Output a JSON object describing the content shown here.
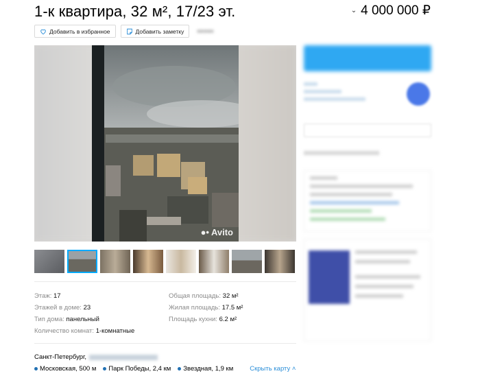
{
  "listing": {
    "title": "1-к квартира, 32 м², 17/23 эт.",
    "price": "4 000 000 ₽"
  },
  "actions": {
    "favorite_label": "Добавить в избранное",
    "note_label": "Добавить заметку"
  },
  "gallery": {
    "watermark": "Avito",
    "thumbnail_count": 8,
    "active_thumbnail": 2
  },
  "params": {
    "floor_label": "Этаж:",
    "floor_value": "17",
    "floors_label": "Этажей в доме:",
    "floors_value": "23",
    "house_type_label": "Тип дома:",
    "house_type_value": "панельный",
    "rooms_label": "Количество комнат:",
    "rooms_value": "1-комнатные",
    "total_area_label": "Общая площадь:",
    "total_area_value": "32 м²",
    "living_area_label": "Жилая площадь:",
    "living_area_value": "17.5 м²",
    "kitchen_area_label": "Площадь кухни:",
    "kitchen_area_value": "6.2 м²"
  },
  "address": {
    "city": "Санкт-Петербург,",
    "metros": [
      {
        "name": "Московская, 500 м",
        "color": "#2271b3"
      },
      {
        "name": "Парк Победы, 2,4 км",
        "color": "#2271b3"
      },
      {
        "name": "Звездная, 1,9 км",
        "color": "#2271b3"
      }
    ],
    "hide_map_label": "Скрыть карту"
  },
  "colors": {
    "accent": "#2fa8f2",
    "link": "#2b8ed8"
  }
}
